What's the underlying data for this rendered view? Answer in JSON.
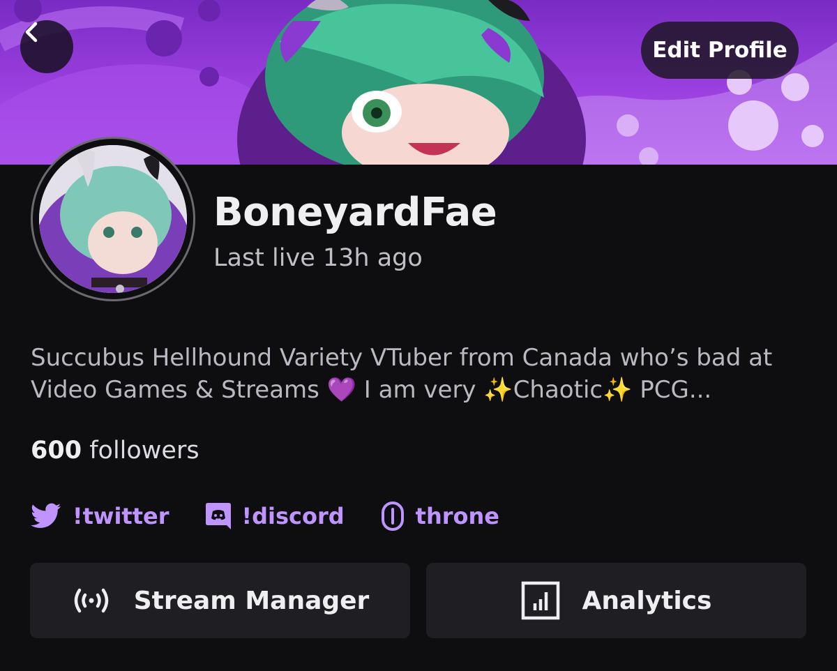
{
  "header": {
    "back_icon": "chevron-left-icon",
    "edit_label": "Edit Profile"
  },
  "profile": {
    "display_name": "BoneyardFae",
    "last_live": "Last live 13h ago",
    "bio": "Succubus Hellhound Variety VTuber from Canada who’s bad at Video Games & Streams 💜 I am very ✨Chaotic✨ PCG...",
    "followers_count": "600",
    "followers_label": "followers"
  },
  "links": [
    {
      "label": "!twitter",
      "icon": "twitter-bird-icon"
    },
    {
      "label": "!discord",
      "icon": "discord-icon"
    },
    {
      "label": "throne",
      "icon": "throne-link-icon"
    }
  ],
  "actions": {
    "stream_manager_label": "Stream Manager",
    "stream_manager_icon": "broadcast-icon",
    "analytics_label": "Analytics",
    "analytics_icon": "bar-chart-icon"
  },
  "colors": {
    "background": "#0e0e10",
    "link": "#bf94ff",
    "button_bg": "#1f1f23",
    "banner_purple": "#9b40e0"
  }
}
